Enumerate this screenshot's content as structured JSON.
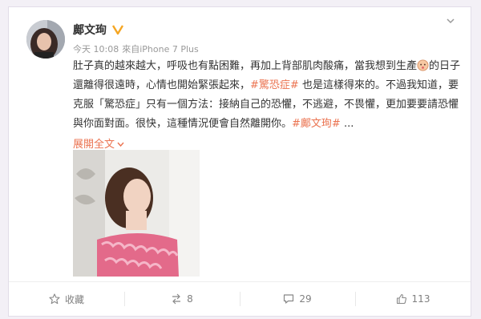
{
  "post": {
    "author": "鄺文珣",
    "time": "今天 10:08",
    "source": "來自iPhone 7 Plus",
    "text": {
      "part1": "肚子真的越來越大，呼吸也有點困難，再加上背部肌肉酸痛，當我想到生產",
      "part2": "的日子還離得很遠時，心情也開始緊張起來，",
      "hashtag1": "#驚恐症#",
      "part3": " 也是這樣得來的。不過我知道，要克服「驚恐症」只有一個方法：接納自己的恐懼，不逃避，不畏懼，更加要要請恐懼與你面對面。很快，這種情況便會自然離開你。",
      "hashtag2": "#鄺文珣#",
      "ellipsis": " ..."
    },
    "expand_label": "展開全文",
    "accent_color": "#eb7350"
  },
  "actions": {
    "favorite": "收藏",
    "repost_count": "8",
    "comment_count": "29",
    "like_count": "113"
  },
  "icons": {
    "menu": "chevron-down-icon",
    "verified": "verified-badge-icon",
    "emoji": "baby-face-emoji",
    "favorite": "star-icon",
    "repost": "repost-icon",
    "comment": "comment-icon",
    "like": "thumbs-up-icon"
  }
}
